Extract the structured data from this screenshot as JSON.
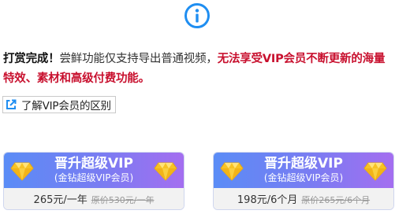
{
  "message": {
    "prefix": "打赏完成！",
    "body": "尝鲜功能仅支持导出普通视频，",
    "warning": "无法享受VIP会员不断更新的海量特效、素材和高级付费功能。"
  },
  "vip_link": {
    "label": "了解VIP会员的区别"
  },
  "plans": [
    {
      "title": "晋升超级VIP",
      "subtitle": "(金钻超级VIP会员)",
      "price": "265元/一年",
      "original_price": "原价530元/一年"
    },
    {
      "title": "晋升超级VIP",
      "subtitle": "(金钻超级VIP会员)",
      "price": "198元/6个月",
      "original_price": "原价265元/6个月"
    }
  ],
  "colors": {
    "info_icon": "#1f8ef1",
    "warning_text": "#c8102e",
    "card_gradient_start": "#5a8cf6",
    "card_gradient_end": "#a46ef0",
    "gem": "#f7c325"
  }
}
